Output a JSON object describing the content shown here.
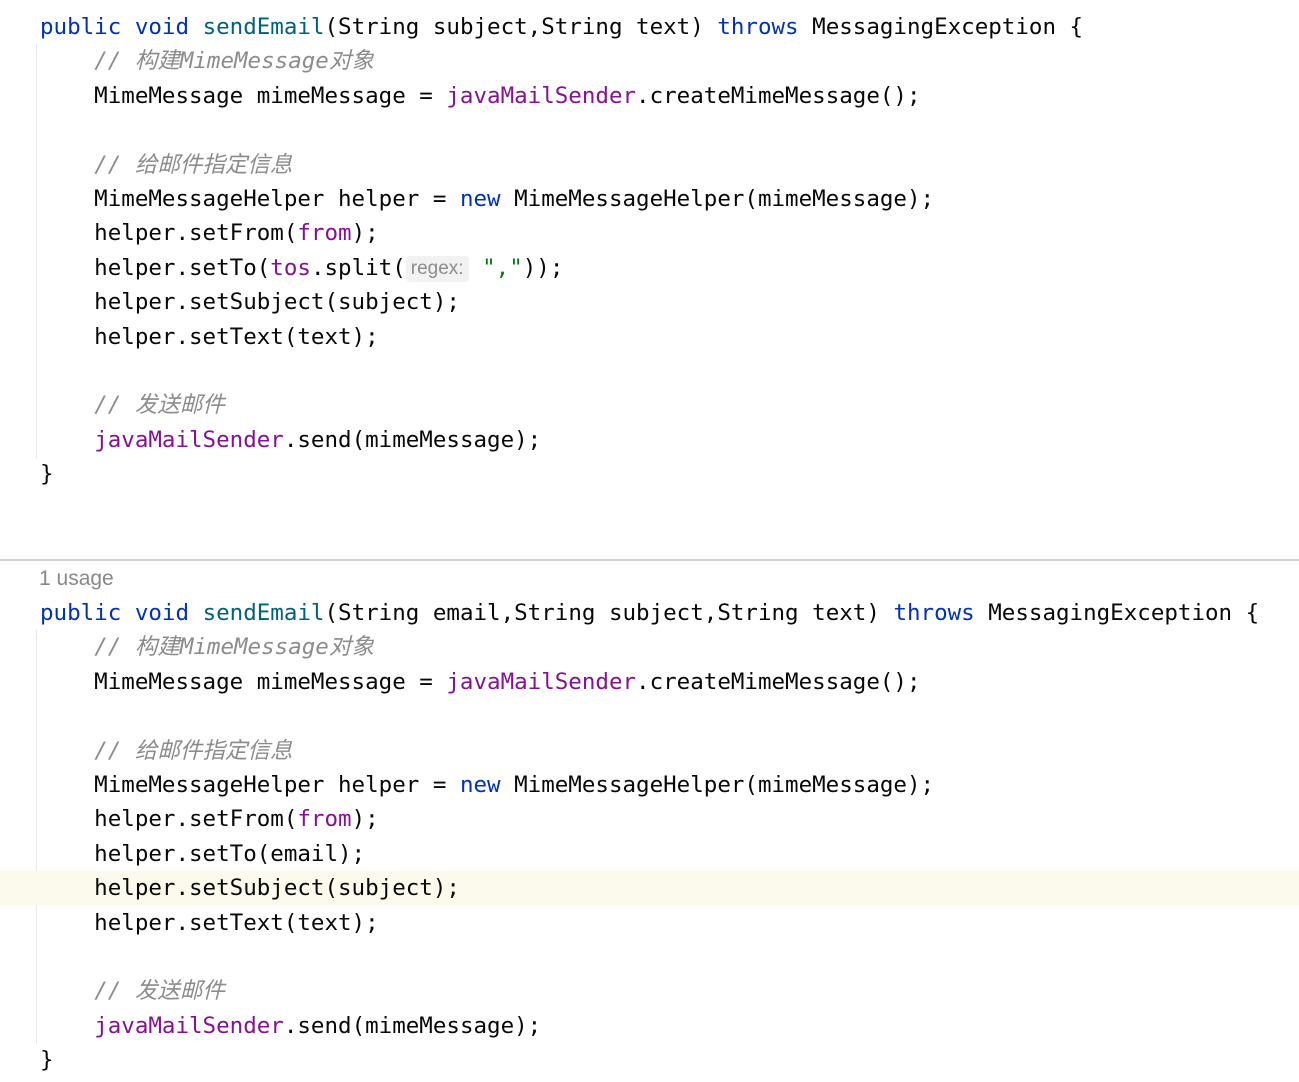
{
  "editor": {
    "language": "Java",
    "top_usage_label": "1 usage",
    "colors": {
      "keyword": "#0033b3",
      "method_declaration": "#00627a",
      "field": "#871094",
      "string": "#067d17",
      "comment": "#8c8c8c",
      "inlay_hint": "#8c8c8c",
      "caret_row_highlight": "#fcfaed",
      "separator": "#d0d0d0"
    }
  },
  "methods": [
    {
      "lines": [
        {
          "tokens": [
            {
              "t": "public",
              "c": "kw"
            },
            {
              "t": " "
            },
            {
              "t": "void",
              "c": "kw"
            },
            {
              "t": " "
            },
            {
              "t": "sendEmail",
              "c": "fn"
            },
            {
              "t": "(String subject,String text) "
            },
            {
              "t": "throws",
              "c": "kw"
            },
            {
              "t": " MessagingException {"
            }
          ]
        },
        {
          "tokens": [
            {
              "t": "    "
            },
            {
              "t": "// 构建MimeMessage对象",
              "c": "cmt"
            }
          ]
        },
        {
          "tokens": [
            {
              "t": "    MimeMessage mimeMessage = "
            },
            {
              "t": "javaMailSender",
              "c": "fld"
            },
            {
              "t": ".createMimeMessage();"
            }
          ]
        },
        {
          "tokens": []
        },
        {
          "tokens": [
            {
              "t": "    "
            },
            {
              "t": "// 给邮件指定信息",
              "c": "cmt"
            }
          ]
        },
        {
          "tokens": [
            {
              "t": "    MimeMessageHelper helper = "
            },
            {
              "t": "new",
              "c": "kw"
            },
            {
              "t": " MimeMessageHelper(mimeMessage);"
            }
          ]
        },
        {
          "tokens": [
            {
              "t": "    helper.setFrom("
            },
            {
              "t": "from",
              "c": "fld"
            },
            {
              "t": ");"
            }
          ]
        },
        {
          "tokens": [
            {
              "t": "    helper.setTo("
            },
            {
              "t": "tos",
              "c": "fld"
            },
            {
              "t": ".split("
            },
            {
              "t": "regex:",
              "c": "hint"
            },
            {
              "t": " "
            },
            {
              "t": "\",\"",
              "c": "str"
            },
            {
              "t": "));"
            }
          ]
        },
        {
          "tokens": [
            {
              "t": "    helper.setSubject(subject);"
            }
          ]
        },
        {
          "tokens": [
            {
              "t": "    helper.setText(text);"
            }
          ]
        },
        {
          "tokens": []
        },
        {
          "tokens": [
            {
              "t": "    "
            },
            {
              "t": "// 发送邮件",
              "c": "cmt"
            }
          ]
        },
        {
          "tokens": [
            {
              "t": "    "
            },
            {
              "t": "javaMailSender",
              "c": "fld"
            },
            {
              "t": ".send(mimeMessage);"
            }
          ]
        },
        {
          "tokens": [
            {
              "t": "}"
            }
          ]
        }
      ]
    },
    {
      "lines": [
        {
          "tokens": [
            {
              "t": "public",
              "c": "kw"
            },
            {
              "t": " "
            },
            {
              "t": "void",
              "c": "kw"
            },
            {
              "t": " "
            },
            {
              "t": "sendEmail",
              "c": "fn"
            },
            {
              "t": "(String email,String subject,String text) "
            },
            {
              "t": "throws",
              "c": "kw"
            },
            {
              "t": " MessagingException {"
            }
          ]
        },
        {
          "tokens": [
            {
              "t": "    "
            },
            {
              "t": "// 构建MimeMessage对象",
              "c": "cmt"
            }
          ]
        },
        {
          "tokens": [
            {
              "t": "    MimeMessage mimeMessage = "
            },
            {
              "t": "javaMailSender",
              "c": "fld"
            },
            {
              "t": ".createMimeMessage();"
            }
          ]
        },
        {
          "tokens": []
        },
        {
          "tokens": [
            {
              "t": "    "
            },
            {
              "t": "// 给邮件指定信息",
              "c": "cmt"
            }
          ]
        },
        {
          "tokens": [
            {
              "t": "    MimeMessageHelper helper = "
            },
            {
              "t": "new",
              "c": "kw"
            },
            {
              "t": " MimeMessageHelper(mimeMessage);"
            }
          ]
        },
        {
          "tokens": [
            {
              "t": "    helper.setFrom("
            },
            {
              "t": "from",
              "c": "fld"
            },
            {
              "t": ");"
            }
          ]
        },
        {
          "tokens": [
            {
              "t": "    helper.setTo(email);"
            }
          ]
        },
        {
          "tokens": [
            {
              "t": "    helper.setSubject(subject);"
            }
          ],
          "highlight": true
        },
        {
          "tokens": [
            {
              "t": "    helper.setText(text);"
            }
          ]
        },
        {
          "tokens": []
        },
        {
          "tokens": [
            {
              "t": "    "
            },
            {
              "t": "// 发送邮件",
              "c": "cmt"
            }
          ]
        },
        {
          "tokens": [
            {
              "t": "    "
            },
            {
              "t": "javaMailSender",
              "c": "fld"
            },
            {
              "t": ".send(mimeMessage);"
            }
          ]
        },
        {
          "tokens": [
            {
              "t": "}"
            }
          ]
        }
      ]
    }
  ]
}
